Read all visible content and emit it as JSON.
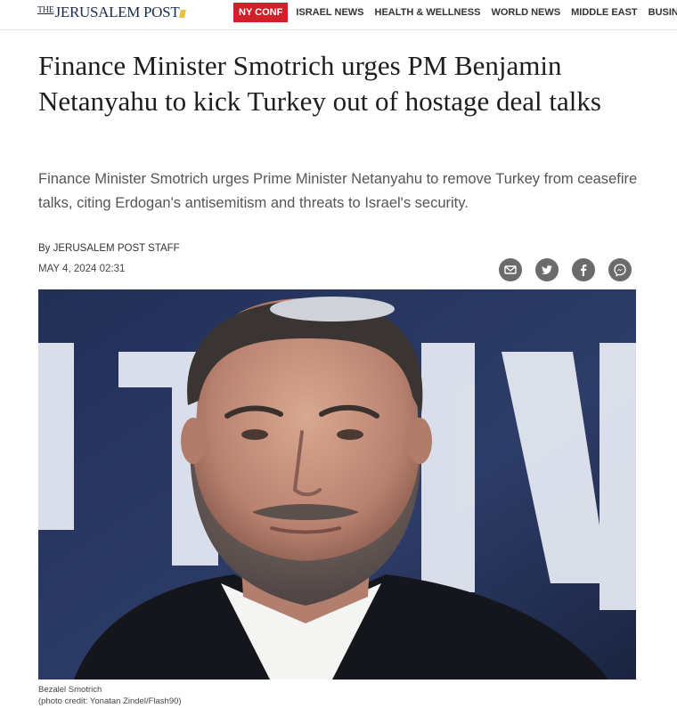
{
  "header": {
    "logo_text": "JERUSALEM POST",
    "logo_the": "THE",
    "highlight_nav": "NY CONF",
    "nav_items": [
      "ISRAEL NEWS",
      "HEALTH & WELLNESS",
      "WORLD NEWS",
      "MIDDLE EAST",
      "BUSINESS &"
    ]
  },
  "article": {
    "headline": "Finance Minister Smotrich urges PM Benjamin Netanyahu to kick Turkey out of hostage deal talks",
    "subhead": "Finance Minister Smotrich urges Prime Minister Netanyahu to remove Turkey from ceasefire talks, citing Erdogan's antisemitism and threats to Israel's security.",
    "byline": "By JERUSALEM POST STAFF",
    "date": "MAY 4, 2024 02:31",
    "share_icons": [
      "email-icon",
      "twitter-icon",
      "facebook-icon",
      "messenger-icon"
    ],
    "photo_caption": "Bezalel Smotrich",
    "photo_credit": "(photo credit: Yonatan Zindel/Flash90)"
  },
  "colors": {
    "accent_red": "#d0202a",
    "share_gray": "#6b6b6b",
    "photo_background": "#26324d"
  }
}
